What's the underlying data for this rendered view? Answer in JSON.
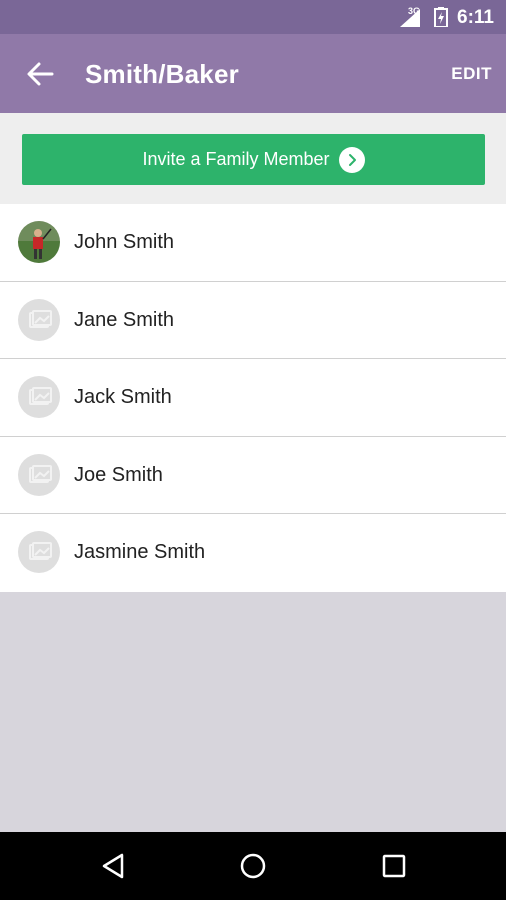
{
  "status_bar": {
    "network": "3G",
    "time": "6:11"
  },
  "app_bar": {
    "title": "Smith/Baker",
    "edit_label": "EDIT",
    "back_icon": "arrow-left-icon"
  },
  "invite": {
    "label": "Invite a Family Member",
    "icon": "chevron-right-circle-icon"
  },
  "members": [
    {
      "name": "John Smith",
      "avatar": "photo-golfer"
    },
    {
      "name": "Jane Smith",
      "avatar": "placeholder-photo-icon"
    },
    {
      "name": "Jack Smith",
      "avatar": "placeholder-photo-icon"
    },
    {
      "name": "Joe Smith",
      "avatar": "placeholder-photo-icon"
    },
    {
      "name": "Jasmine Smith",
      "avatar": "placeholder-photo-icon"
    }
  ],
  "nav_bar": {
    "buttons": [
      "back-triangle-icon",
      "home-circle-icon",
      "recents-square-icon"
    ]
  },
  "colors": {
    "status_bar": "#7a6797",
    "app_bar": "#9079a8",
    "invite_button": "#2db36b",
    "background": "#d7d5dc"
  }
}
